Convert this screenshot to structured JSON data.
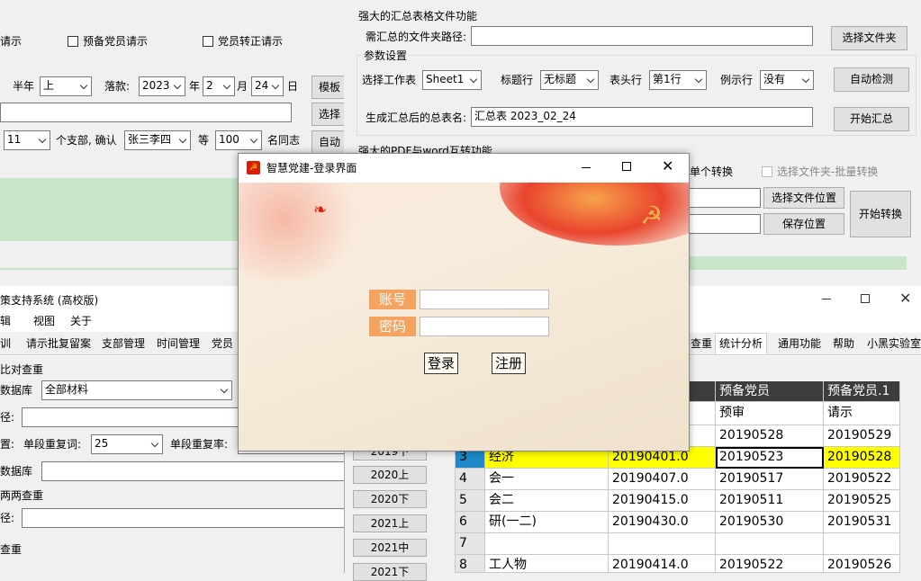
{
  "left_top": {
    "checkbox1_label": "预备党员请示",
    "checkbox2_label": "党员转正请示",
    "partial1": "请示",
    "half_year_label": "半年",
    "half_year_value": "上",
    "deadline_label": "落款:",
    "year_value": "2023",
    "year_label": "年",
    "month_value": "2",
    "month_label": "月",
    "day_value": "24",
    "day_label": "日",
    "btn_mo": "模板",
    "btn_select": "选择",
    "count_value": "11",
    "branch_text": "个支部, 确认",
    "names_value": "张三李四",
    "etc_label": "等",
    "people_value": "100",
    "people_label": "名同志",
    "btn_zi": "自动"
  },
  "summary": {
    "title": "强大的汇总表格文件功能",
    "folder_label": "需汇总的文件夹路径:",
    "folder_value": "",
    "select_folder_btn": "选择文件夹",
    "params_title": "参数设置",
    "sheet_label": "选择工作表",
    "sheet_value": "Sheet1",
    "title_row_label": "标题行",
    "title_row_value": "无标题",
    "header_row_label": "表头行",
    "header_row_value": "第1行",
    "example_row_label": "例示行",
    "example_row_value": "没有",
    "auto_detect_btn": "自动检测",
    "result_name_label": "生成汇总后的总表名:",
    "result_name_value": "汇总表 2023_02_24",
    "start_btn": "开始汇总"
  },
  "pdf": {
    "title": "强大的PDF与word互转功能",
    "single_label": "单个转换",
    "batch_label": "选择文件夹-批量转换",
    "select_location_btn": "选择文件位置",
    "save_location_btn": "保存位置",
    "start_convert_btn": "开始转换"
  },
  "decision": {
    "title": "策支持系统 (高校版)",
    "menu": [
      "辑",
      "视图",
      "关于"
    ],
    "tabs": [
      "训",
      "请示批复留案",
      "支部管理",
      "时间管理",
      "党员"
    ],
    "compare_title": "比对查重",
    "db_label": "数据库",
    "db_value": "全部材料",
    "path_label": "径:",
    "setting_label": "置:",
    "single_dup_label": "单段重复词:",
    "single_dup_value": "25",
    "single_rate_label": "单段重复率:",
    "db2_label": "数据库",
    "pair_title": "两两查重",
    "path2_label": "径:",
    "dup_title": "查重"
  },
  "stats_window": {
    "tabs": [
      "查重",
      "统计分析",
      "通用功能",
      "帮助",
      "小黑实验室"
    ],
    "years": [
      "2019下",
      "2020上",
      "2020下",
      "2021上",
      "2021中",
      "2021下"
    ],
    "headers": [
      "预备党员",
      "预备党员.1"
    ],
    "subheaders": [
      "预审",
      "请示"
    ],
    "rows": [
      {
        "idx": "",
        "name": "",
        "date": "",
        "a": "20190528",
        "b": "20190529"
      },
      {
        "idx": "3",
        "name": "经济",
        "date": "20190401.0",
        "a": "20190523",
        "b": "20190528"
      },
      {
        "idx": "4",
        "name": "会一",
        "date": "20190407.0",
        "a": "20190517",
        "b": "20190522"
      },
      {
        "idx": "5",
        "name": "会二",
        "date": "20190415.0",
        "a": "20190511",
        "b": "20190525"
      },
      {
        "idx": "6",
        "name": "研(一二)",
        "date": "20190430.0",
        "a": "20190530",
        "b": "20190531"
      },
      {
        "idx": "7",
        "name": "",
        "date": "",
        "a": "",
        "b": ""
      },
      {
        "idx": "8",
        "name": "工人物",
        "date": "20190414.0",
        "a": "20190522",
        "b": "20190526"
      }
    ]
  },
  "login": {
    "title": "智慧党建-登录界面",
    "account_label": "账号",
    "password_label": "密码",
    "account_value": "",
    "password_value": "",
    "login_btn": "登录",
    "register_btn": "注册",
    "accent": "#f4a460"
  }
}
